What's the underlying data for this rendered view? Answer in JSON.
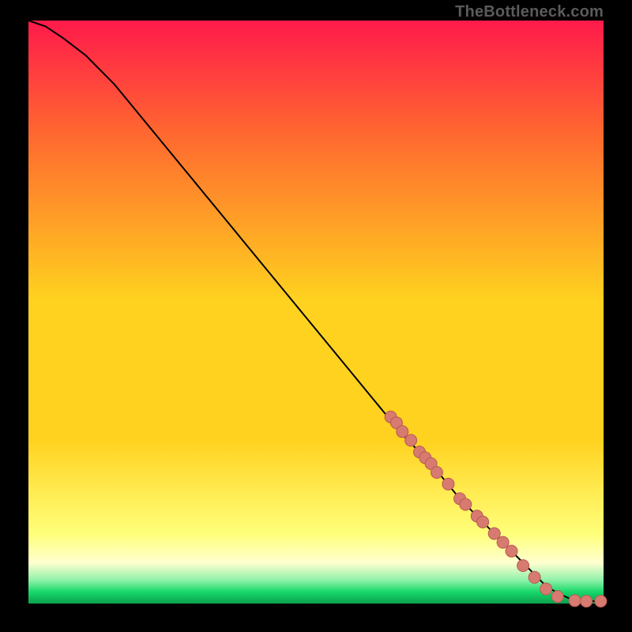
{
  "watermark": "TheBottleneck.com",
  "colors": {
    "background": "#000000",
    "grad_top": "#ff1a4b",
    "grad_mid_upper": "#ff6a2f",
    "grad_mid": "#ffd21f",
    "grad_mid_lower": "#ffff7a",
    "grad_low": "#ffffd0",
    "grad_green1": "#8ff2a8",
    "grad_green2": "#17d86a",
    "grad_bottom": "#0aa04c",
    "curve": "#000000",
    "marker_fill": "#d77a70",
    "marker_stroke": "#b85a52"
  },
  "chart_data": {
    "type": "line",
    "title": "",
    "xlabel": "",
    "ylabel": "",
    "xlim": [
      0,
      100
    ],
    "ylim": [
      0,
      100
    ],
    "grid": false,
    "series": [
      {
        "name": "curve",
        "x": [
          0,
          3,
          6,
          10,
          15,
          20,
          25,
          30,
          35,
          40,
          45,
          50,
          55,
          60,
          65,
          70,
          75,
          80,
          85,
          88,
          90,
          92,
          94,
          96,
          98,
          100
        ],
        "y": [
          100,
          99,
          97,
          94,
          89,
          83,
          77,
          71,
          65,
          59,
          53,
          47,
          41,
          35,
          29,
          24,
          18,
          13,
          8,
          5,
          3,
          1.8,
          0.9,
          0.5,
          0.4,
          0.4
        ]
      }
    ],
    "markers": [
      {
        "x": 63,
        "y": 32
      },
      {
        "x": 64,
        "y": 31
      },
      {
        "x": 65,
        "y": 29.5
      },
      {
        "x": 66.5,
        "y": 28
      },
      {
        "x": 68,
        "y": 26
      },
      {
        "x": 69,
        "y": 25
      },
      {
        "x": 70,
        "y": 24
      },
      {
        "x": 71,
        "y": 22.5
      },
      {
        "x": 73,
        "y": 20.5
      },
      {
        "x": 75,
        "y": 18
      },
      {
        "x": 76,
        "y": 17
      },
      {
        "x": 78,
        "y": 15
      },
      {
        "x": 79,
        "y": 14
      },
      {
        "x": 81,
        "y": 12
      },
      {
        "x": 82.5,
        "y": 10.5
      },
      {
        "x": 84,
        "y": 9
      },
      {
        "x": 86,
        "y": 6.5
      },
      {
        "x": 88,
        "y": 4.5
      },
      {
        "x": 90,
        "y": 2.5
      },
      {
        "x": 92,
        "y": 1.2
      },
      {
        "x": 95,
        "y": 0.5
      },
      {
        "x": 97,
        "y": 0.4
      },
      {
        "x": 99.5,
        "y": 0.4
      }
    ]
  }
}
